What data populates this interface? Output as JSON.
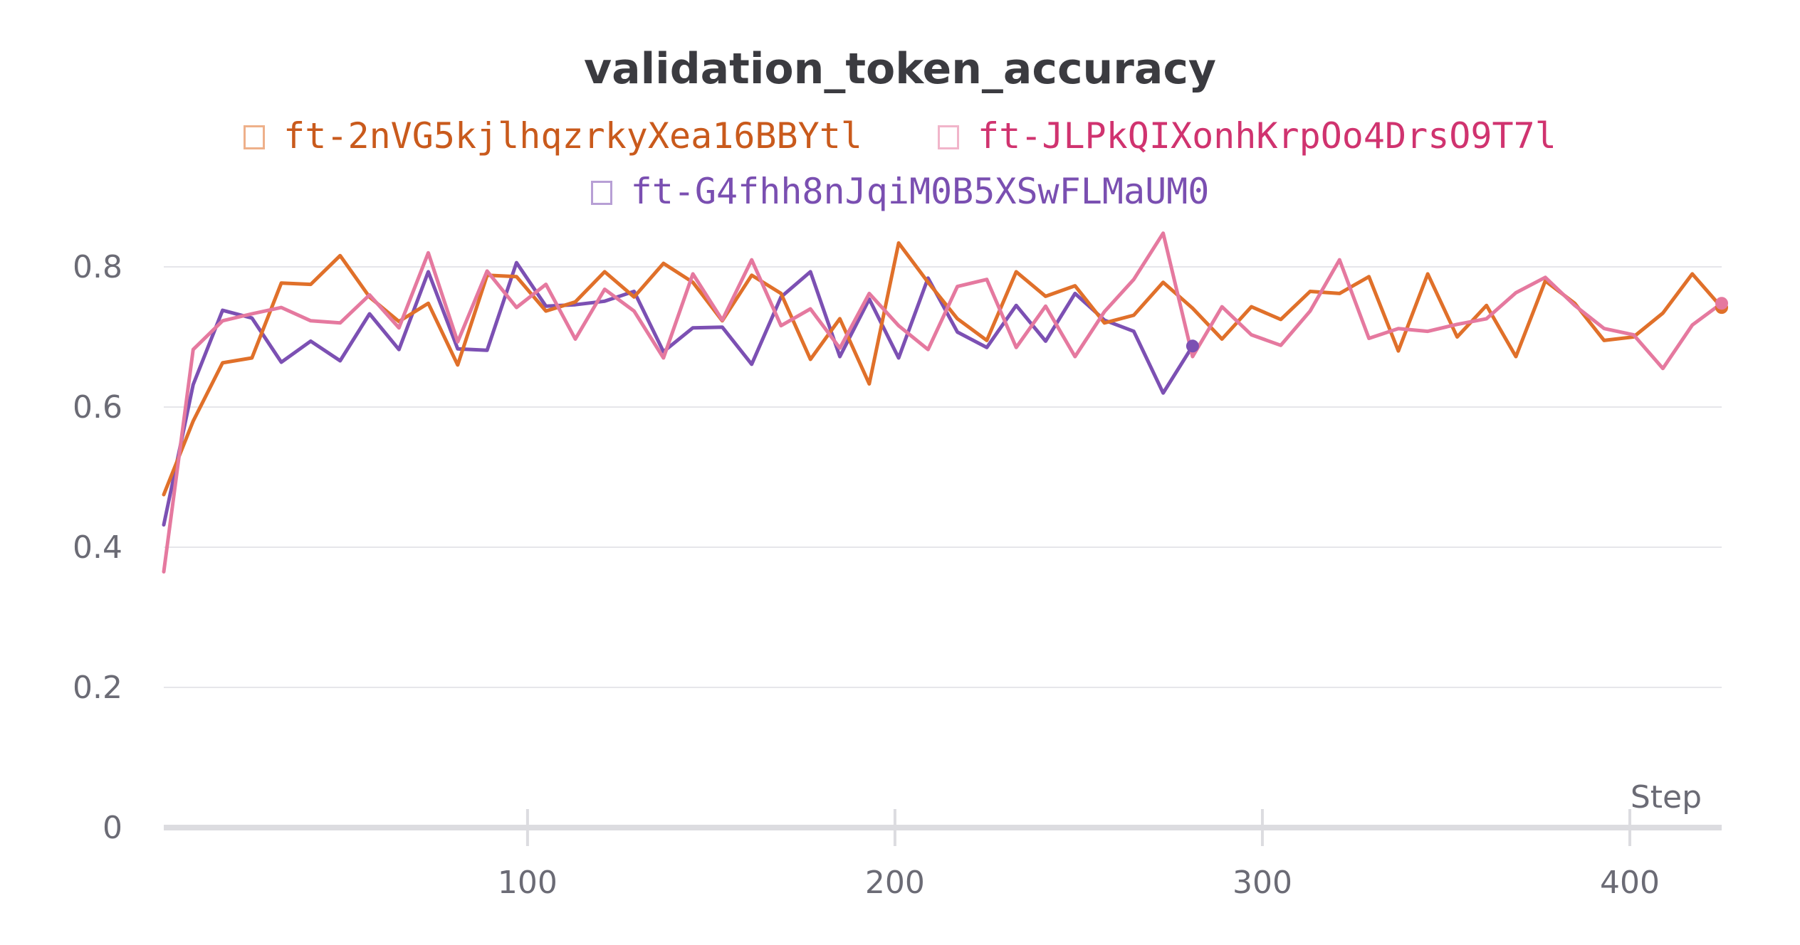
{
  "chart_data": {
    "type": "line",
    "title": "validation_token_accuracy",
    "xlabel": "Step",
    "ylabel": "",
    "xlim": [
      1,
      425
    ],
    "ylim": [
      0,
      0.85
    ],
    "x_ticks": [
      "100",
      "200",
      "300",
      "400"
    ],
    "y_ticks": [
      "0",
      "0.2",
      "0.4",
      "0.6",
      "0.8"
    ],
    "grid": "horizontal",
    "legend_position": "top-center",
    "series": [
      {
        "name": "ft-2nVG5kjlhqzrkyXea16BBYtl",
        "color": "#e0702a",
        "x": [
          1,
          9,
          17,
          25,
          33,
          41,
          49,
          57,
          65,
          73,
          81,
          89,
          97,
          105,
          113,
          121,
          129,
          137,
          145,
          153,
          161,
          169,
          177,
          185,
          193,
          201,
          209,
          217,
          225,
          233,
          241,
          249,
          257,
          265,
          273,
          281,
          289,
          297,
          305,
          313,
          321,
          329,
          337,
          345,
          353,
          361,
          369,
          377,
          385,
          393,
          401,
          409,
          417,
          425
        ],
        "values": [
          0.475,
          0.58,
          0.663,
          0.67,
          0.777,
          0.775,
          0.816,
          0.757,
          0.722,
          0.748,
          0.66,
          0.788,
          0.786,
          0.737,
          0.75,
          0.793,
          0.757,
          0.805,
          0.778,
          0.723,
          0.788,
          0.762,
          0.668,
          0.726,
          0.633,
          0.834,
          0.778,
          0.726,
          0.695,
          0.793,
          0.758,
          0.773,
          0.72,
          0.731,
          0.778,
          0.741,
          0.697,
          0.743,
          0.725,
          0.765,
          0.762,
          0.786,
          0.68,
          0.79,
          0.7,
          0.745,
          0.672,
          0.78,
          0.748,
          0.695,
          0.7,
          0.734,
          0.79,
          0.742
        ]
      },
      {
        "name": "ft-JLPkQIXonhKrpOo4DrsO9T7l",
        "color": "#e5799f",
        "x": [
          1,
          9,
          17,
          25,
          33,
          41,
          49,
          57,
          65,
          73,
          81,
          89,
          97,
          105,
          113,
          121,
          129,
          137,
          145,
          153,
          161,
          169,
          177,
          185,
          193,
          201,
          209,
          217,
          225,
          233,
          241,
          249,
          257,
          265,
          273,
          281,
          289,
          297,
          305,
          313,
          321,
          329,
          337,
          345,
          353,
          361,
          369,
          377,
          385,
          393,
          401,
          409,
          417,
          425
        ],
        "values": [
          0.365,
          0.682,
          0.723,
          0.733,
          0.742,
          0.723,
          0.72,
          0.76,
          0.713,
          0.82,
          0.693,
          0.794,
          0.742,
          0.775,
          0.697,
          0.768,
          0.737,
          0.67,
          0.79,
          0.724,
          0.81,
          0.716,
          0.74,
          0.684,
          0.762,
          0.716,
          0.682,
          0.772,
          0.782,
          0.685,
          0.744,
          0.672,
          0.736,
          0.782,
          0.848,
          0.672,
          0.743,
          0.703,
          0.688,
          0.737,
          0.81,
          0.698,
          0.712,
          0.708,
          0.718,
          0.726,
          0.763,
          0.785,
          0.745,
          0.712,
          0.703,
          0.655,
          0.717,
          0.748
        ]
      },
      {
        "name": "ft-G4fhh8nJqiM0B5XSwFLMaUM0",
        "color": "#7c50b3",
        "x": [
          1,
          9,
          17,
          25,
          33,
          41,
          49,
          57,
          65,
          73,
          81,
          89,
          97,
          105,
          113,
          121,
          129,
          137,
          145,
          153,
          161,
          169,
          177,
          185,
          193,
          201,
          209,
          217,
          225,
          233,
          241,
          249,
          257,
          265,
          273,
          281
        ],
        "values": [
          0.432,
          0.632,
          0.738,
          0.727,
          0.664,
          0.694,
          0.666,
          0.733,
          0.682,
          0.793,
          0.683,
          0.681,
          0.806,
          0.744,
          0.746,
          0.751,
          0.765,
          0.679,
          0.713,
          0.714,
          0.661,
          0.757,
          0.793,
          0.672,
          0.754,
          0.67,
          0.784,
          0.707,
          0.685,
          0.745,
          0.694,
          0.762,
          0.724,
          0.708,
          0.62,
          0.687
        ]
      }
    ]
  }
}
